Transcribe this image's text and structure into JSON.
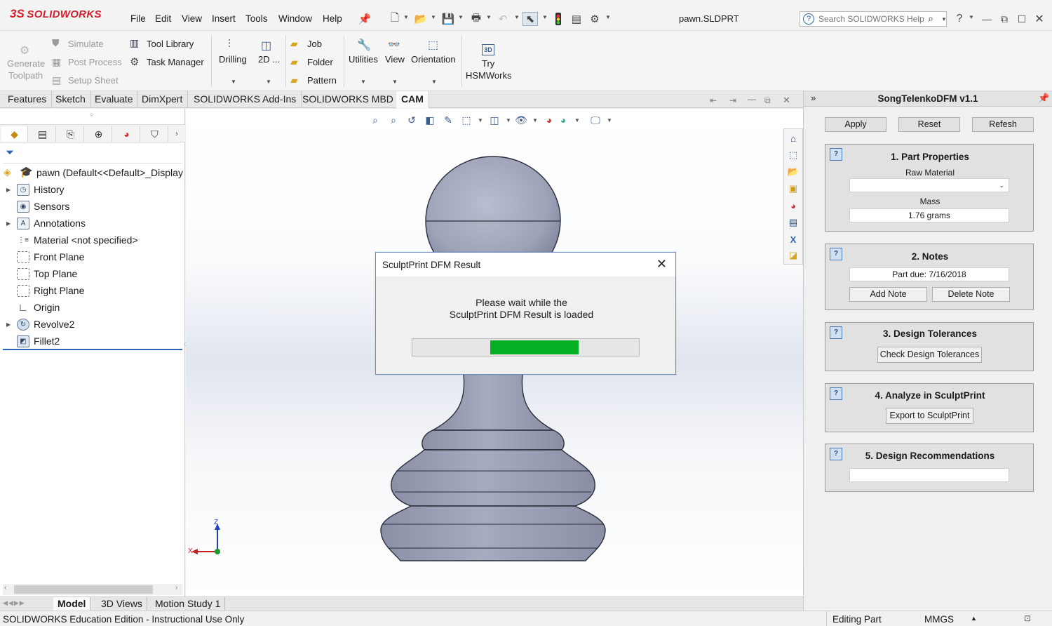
{
  "app": {
    "logo_prefix": "3S",
    "logo_text": "SOLIDWORKS",
    "document_title": "pawn.SLDPRT",
    "menu": [
      "File",
      "Edit",
      "View",
      "Insert",
      "Tools",
      "Window",
      "Help"
    ],
    "help_search": {
      "placeholder": "Search SOLIDWORKS Help"
    },
    "window_buttons": [
      "?",
      "restore",
      "maximize",
      "close"
    ]
  },
  "command_manager": {
    "generate_toolpath": [
      "Generate",
      "Toolpath"
    ],
    "simulate": "Simulate",
    "post_process": "Post Process",
    "setup_sheet": "Setup Sheet",
    "tool_library": "Tool Library",
    "task_manager": "Task Manager",
    "drilling": "Drilling",
    "two_d": "2D ...",
    "job": "Job",
    "folder": "Folder",
    "pattern": "Pattern",
    "utilities": "Utilities",
    "view": "View",
    "orientation": "Orientation",
    "try_hsm": [
      "Try",
      "HSMWorks"
    ],
    "hsm_badge": "3D"
  },
  "tabs": [
    "Features",
    "Sketch",
    "Evaluate",
    "DimXpert",
    "SOLIDWORKS Add-Ins",
    "SOLIDWORKS MBD",
    "CAM"
  ],
  "active_tab": "CAM",
  "feature_tree": {
    "root": "pawn  (Default<<Default>_Display",
    "items": [
      {
        "label": "History",
        "expandable": true
      },
      {
        "label": "Sensors",
        "expandable": false
      },
      {
        "label": "Annotations",
        "expandable": true
      },
      {
        "label": "Material <not specified>",
        "expandable": false
      },
      {
        "label": "Front Plane",
        "expandable": false
      },
      {
        "label": "Top Plane",
        "expandable": false
      },
      {
        "label": "Right Plane",
        "expandable": false
      },
      {
        "label": "Origin",
        "expandable": false
      },
      {
        "label": "Revolve2",
        "expandable": true
      },
      {
        "label": "Fillet2",
        "expandable": false
      }
    ]
  },
  "triad": {
    "x": "X",
    "z": "Z"
  },
  "bottom_tabs": [
    "Model",
    "3D Views",
    "Motion Study 1"
  ],
  "status_bar": {
    "left": "SOLIDWORKS Education Edition - Instructional Use Only",
    "mode": "Editing Part",
    "units": "MMGS"
  },
  "dialog": {
    "title": "SculptPrint DFM Result",
    "message": "Please wait while the\nSculptPrint DFM Result is loaded",
    "progress": {
      "start_fraction": 0.345,
      "end_fraction": 0.735
    },
    "progress_color": "#06b025"
  },
  "task_pane": {
    "title": "SongTelenkoDFM v1.1",
    "buttons": [
      "Apply",
      "Reset",
      "Refesh"
    ],
    "help_glyph": "?",
    "groups": {
      "part_properties": {
        "title": "1. Part Properties",
        "raw_material_label": "Raw Material",
        "raw_material_value": "",
        "mass_label": "Mass",
        "mass_value": "1.76 grams"
      },
      "notes": {
        "title": "2. Notes",
        "note_value": "Part due: 7/16/2018",
        "add_button": "Add Note",
        "delete_button": "Delete Note"
      },
      "design_tolerances": {
        "title": "3. Design Tolerances",
        "button": "Check Design Tolerances"
      },
      "analyze": {
        "title": "4. Analyze in SculptPrint",
        "button": "Export to SculptPrint"
      },
      "recommendations": {
        "title": "5. Design Recommendations",
        "value": ""
      }
    }
  },
  "colors": {
    "brand_red": "#d4202c",
    "selection_blue": "#2b64b8",
    "model_gray": "#9ea3b8"
  }
}
